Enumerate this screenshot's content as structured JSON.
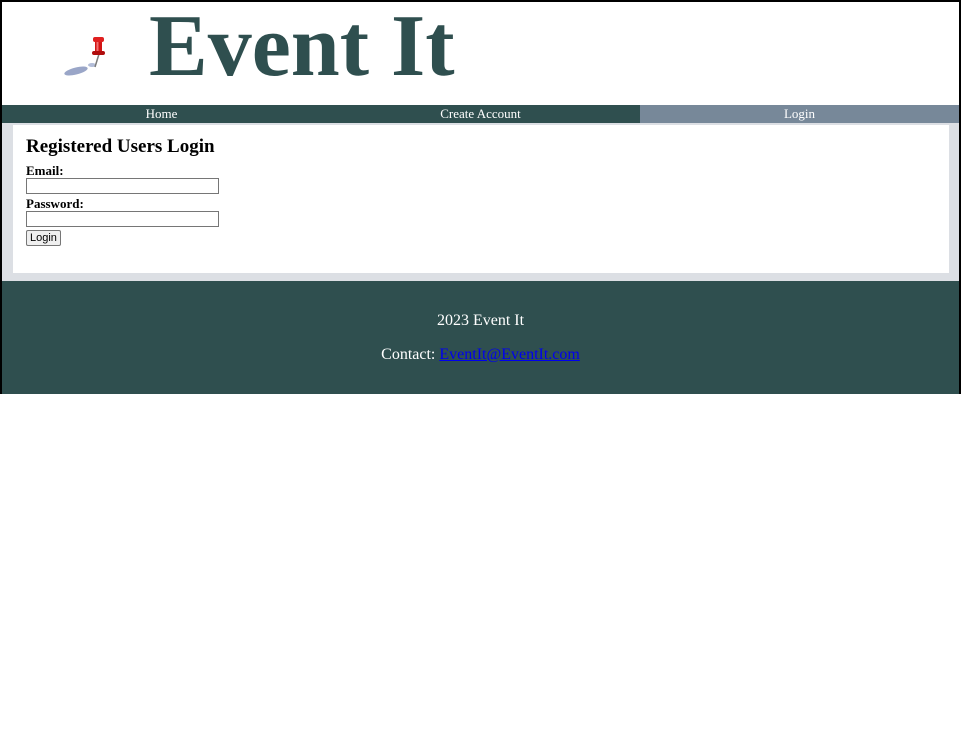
{
  "header": {
    "title": "Event It",
    "logo_icon": "pushpin-icon"
  },
  "nav": {
    "items": [
      {
        "label": "Home",
        "active": false
      },
      {
        "label": "Create Account",
        "active": false
      },
      {
        "label": "Login",
        "active": true
      }
    ]
  },
  "login": {
    "heading": "Registered Users Login",
    "email_label": "Email:",
    "email_value": "",
    "password_label": "Password:",
    "password_value": "",
    "button_label": "Login"
  },
  "footer": {
    "copyright": "2023 Event It",
    "contact_label": "Contact:",
    "contact_email": "EventIt@EventIt.com"
  },
  "colors": {
    "brand": "#2f4f4f",
    "nav_active": "#778899",
    "content_frame": "#dcdfe4",
    "link": "#0000ee"
  }
}
